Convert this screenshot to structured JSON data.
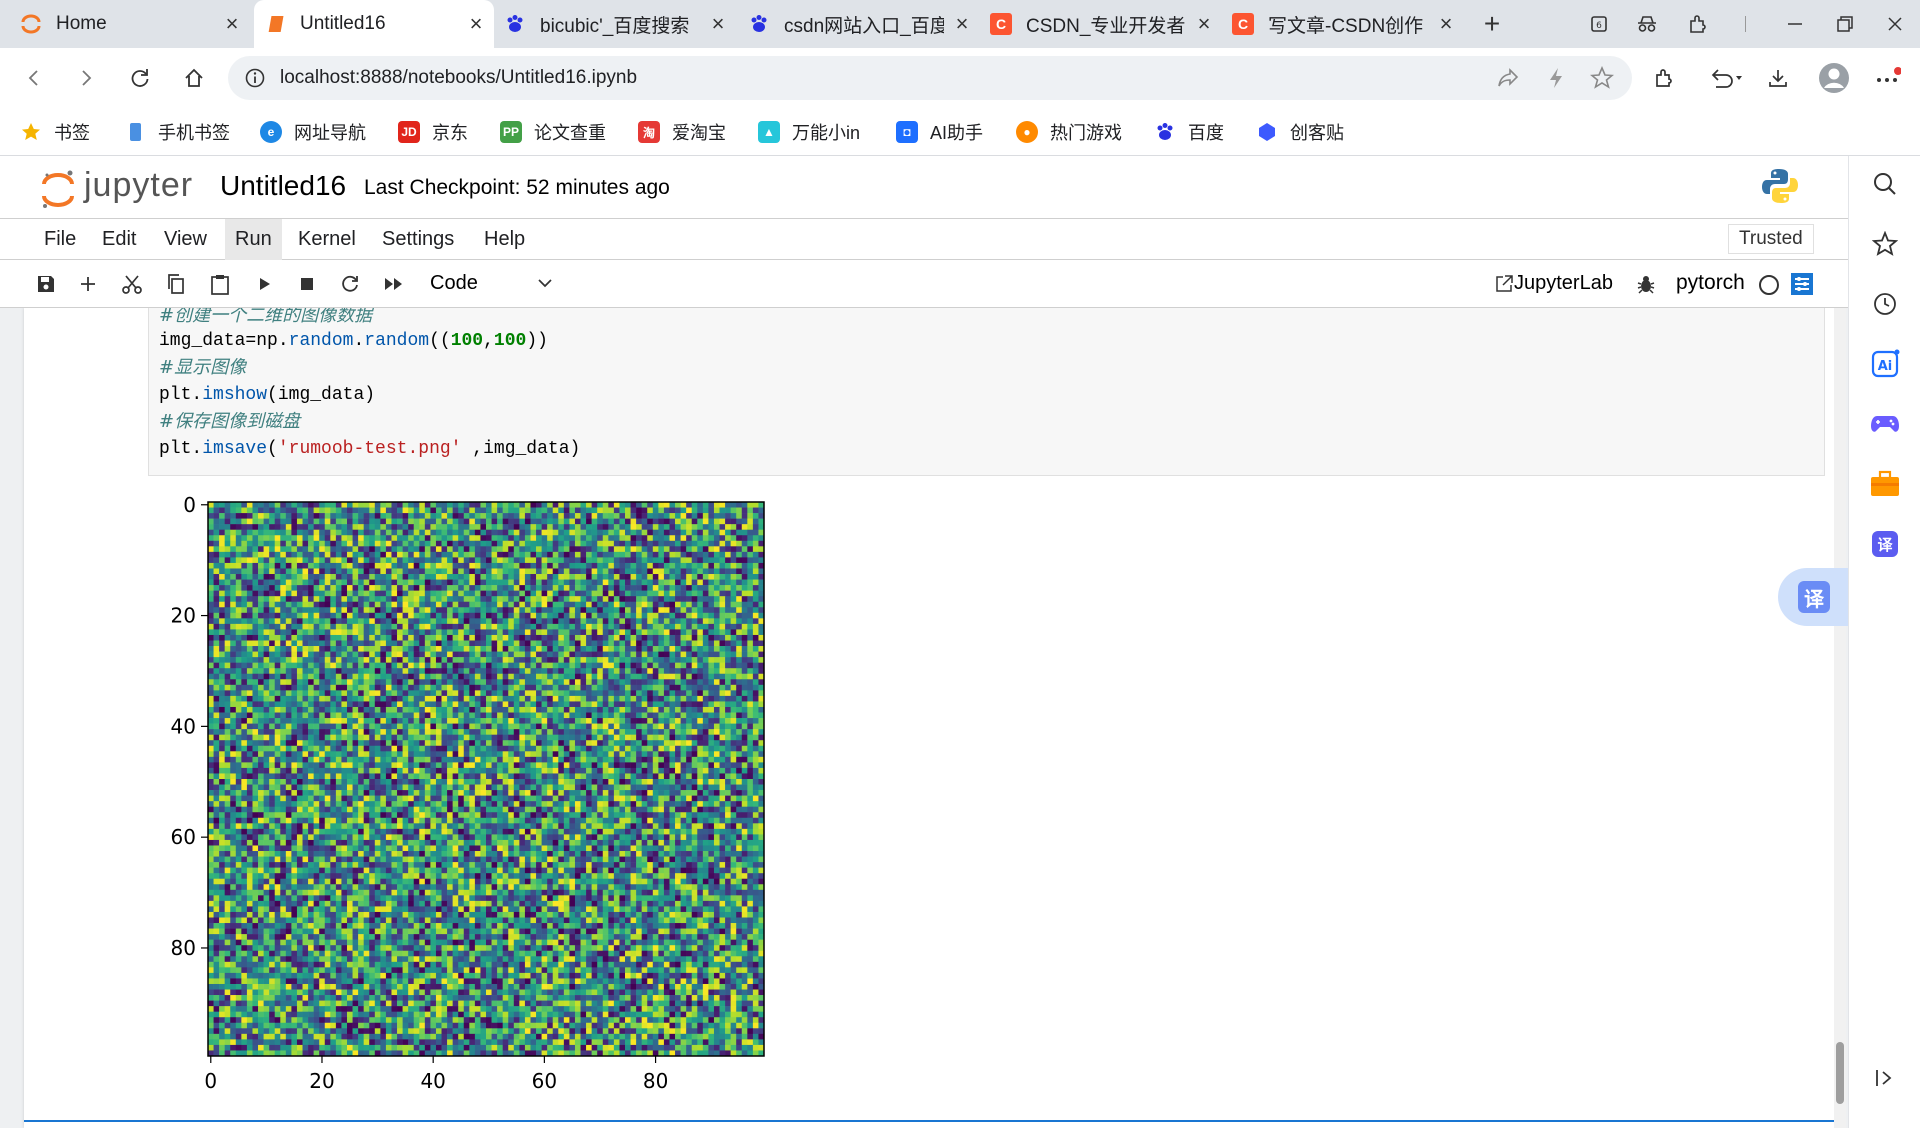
{
  "tabs": [
    {
      "title": "Home",
      "fav": "jupyter-icon"
    },
    {
      "title": "Untitled16",
      "fav": "notebook-icon",
      "active": true
    },
    {
      "title": "bicubic'_百度搜索",
      "fav": "baidu-paw-icon"
    },
    {
      "title": "csdn网站入口_百度",
      "fav": "baidu-paw-icon"
    },
    {
      "title": "CSDN_专业开发者",
      "fav": "csdn-icon"
    },
    {
      "title": "写文章-CSDN创作",
      "fav": "csdn-icon"
    }
  ],
  "address": {
    "url": "localhost:8888/notebooks/Untitled16.ipynb"
  },
  "bookmarks": [
    {
      "label": "书签",
      "icon": "star-icon",
      "color": "#f5b400"
    },
    {
      "label": "手机书签",
      "icon": "phone-icon",
      "color": "#4a90e2"
    },
    {
      "label": "网址导航",
      "icon": "nav-icon",
      "color": "#1e88e5"
    },
    {
      "label": "京东",
      "icon": "jd-icon",
      "color": "#e1251b",
      "glyph": "JD"
    },
    {
      "label": "论文查重",
      "icon": "pp-icon",
      "color": "#43a047",
      "glyph": "PP"
    },
    {
      "label": "爱淘宝",
      "icon": "taobao-icon",
      "color": "#e53935",
      "glyph": "淘"
    },
    {
      "label": "万能小in",
      "icon": "wanneng-icon",
      "color": "#26c6da"
    },
    {
      "label": "AI助手",
      "icon": "ai-icon",
      "color": "#1e6fff"
    },
    {
      "label": "热门游戏",
      "icon": "game-icon",
      "color": "#ff8a00"
    },
    {
      "label": "百度",
      "icon": "baidu-paw-icon",
      "color": "#2932e1"
    },
    {
      "label": "创客贴",
      "icon": "chuangketie-icon",
      "color": "#3d5afe"
    }
  ],
  "jupyter": {
    "logo_text": "jupyter",
    "notebook_name": "Untitled16",
    "checkpoint": "Last Checkpoint: 52 minutes ago",
    "menus": [
      "File",
      "Edit",
      "View",
      "Run",
      "Kernel",
      "Settings",
      "Help"
    ],
    "trusted": "Trusted",
    "cell_type": "Code",
    "jupyterlab_label": "JupyterLab",
    "kernel_name": "pytorch"
  },
  "code": {
    "comment1": "#创建一个二维的图像数据",
    "line2_var": "img_data",
    "line2_mod": "np",
    "line2_a1": "random",
    "line2_a2": "random",
    "line2_n1": "100",
    "line2_n2": "100",
    "comment2": "#显示图像",
    "line4_mod": "plt",
    "line4_fn": "imshow",
    "line4_arg": "img_data",
    "comment3": "#保存图像到磁盘",
    "line6_mod": "plt",
    "line6_fn": "imsave",
    "line6_str": "'rumoob-test.png'",
    "line6_arg": "img_data"
  },
  "chart_data": {
    "type": "heatmap",
    "colormap": "viridis",
    "rows": 100,
    "cols": 100,
    "value_range": [
      0,
      1
    ],
    "xlim": [
      0,
      100
    ],
    "ylim": [
      100,
      0
    ],
    "xticks": [
      "0",
      "20",
      "40",
      "60",
      "80"
    ],
    "yticks": [
      "0",
      "20",
      "40",
      "60",
      "80"
    ],
    "title": "",
    "xlabel": "",
    "ylabel": ""
  },
  "translate_label": "译"
}
